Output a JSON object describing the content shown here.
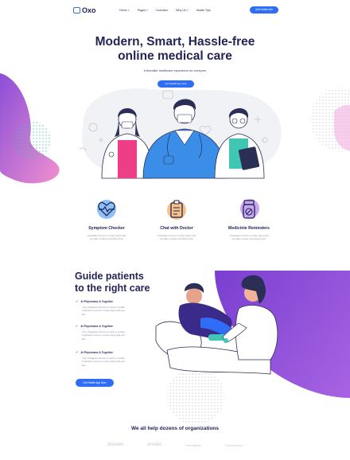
{
  "nav": {
    "logo": "Oxo",
    "links": [
      "Home ˅",
      "Pages ˅",
      "Overview",
      "Why Us ˅",
      "Health Tips"
    ],
    "cta": "Add Health Info"
  },
  "hero": {
    "title_line1": "Modern, Smart, Hassle-free",
    "title_line2": "online medical care",
    "subtitle": "A friendlier healthcare experience for everyone",
    "button": "Get Health App Now"
  },
  "features": [
    {
      "title": "Symptom Checker",
      "desc1": "Inspiration comes in many ways and",
      "desc2": "you like to save everything from",
      "icon": "heart-pulse-icon"
    },
    {
      "title": "Chat with Doctor",
      "desc1": "Inspiration comes in many ways and",
      "desc2": "you like to save everything from",
      "icon": "clipboard-chat-icon"
    },
    {
      "title": "Medicinie Reminders",
      "desc1": "Inspiration comes in many ways and",
      "desc2": "you like to save everything from",
      "icon": "pill-bottle-icon"
    }
  ],
  "guide": {
    "title_line1": "Guide patients",
    "title_line2": "to the right care",
    "items": [
      {
        "title": "AI Physicians & Together",
        "desc1": "Your Instagram throws on web or mobile",
        "desc2": "inspiration comes in many ways and you",
        "desc3": "like"
      },
      {
        "title": "AI Physicians & Together",
        "desc1": "Your Instagram throws on web or mobile",
        "desc2": "inspiration comes in many ways and you",
        "desc3": "like"
      },
      {
        "title": "AI Physicians & Together",
        "desc1": "Your Instagram throws on web or mobile",
        "desc2": "inspiration comes in many ways and you",
        "desc3": "like"
      }
    ],
    "button": "Get Health App Now"
  },
  "organizations": {
    "title": "We all help dozens of organizations",
    "logos": [
      "Jdonlen",
      "envato",
      "PremiBase",
      "Scalecanyon"
    ]
  },
  "colors": {
    "accent": "#2f6df6",
    "purple": "#8b4fd8",
    "pink": "#e98fd2",
    "teal": "#3fc7b4",
    "navy": "#232556"
  }
}
